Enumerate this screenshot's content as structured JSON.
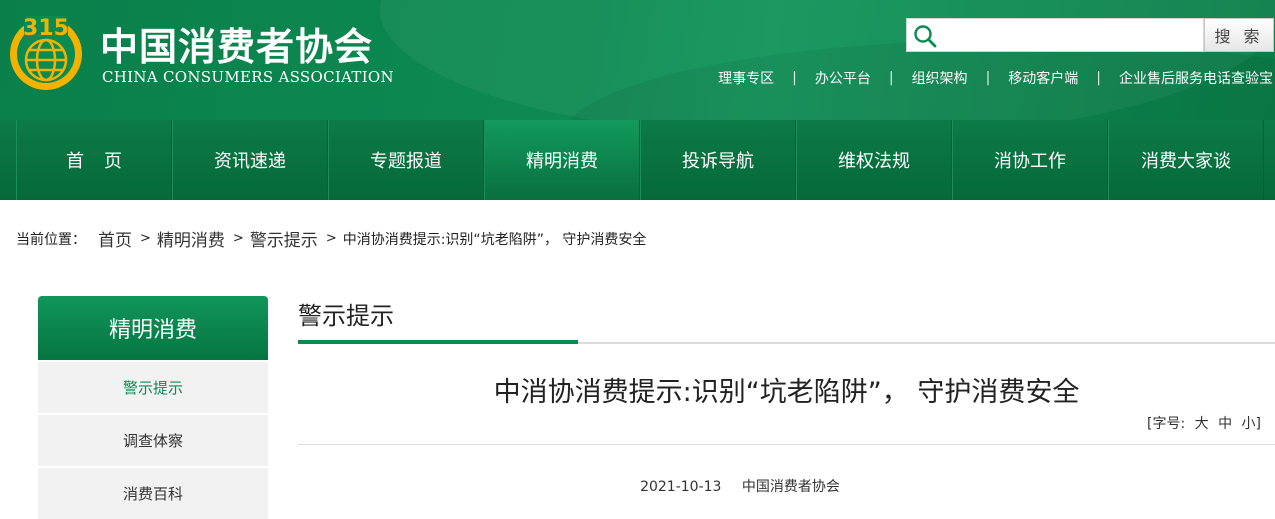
{
  "header": {
    "title": "中国消费者协会",
    "subtitle": "CHINA CONSUMERS ASSOCIATION",
    "logo_text": "315",
    "search": {
      "placeholder": "",
      "button_label": "搜 索"
    },
    "top_links": [
      "理事专区",
      "办公平台",
      "组织架构",
      "移动客户端",
      "企业售后服务电话查验宝"
    ],
    "separator": "|"
  },
  "nav": {
    "items": [
      "首页",
      "资讯速递",
      "专题报道",
      "精明消费",
      "投诉导航",
      "维权法规",
      "消协工作",
      "消费大家谈"
    ],
    "active_index": 3
  },
  "breadcrumb": {
    "prefix": "当前位置：",
    "items": [
      "首页",
      "精明消费",
      "警示提示",
      "中消协消费提示:识别“坑老陷阱”， 守护消费安全"
    ],
    "arrow": ">"
  },
  "sidebar": {
    "title": "精明消费",
    "items": [
      "警示提示",
      "调查体察",
      "消费百科"
    ],
    "active_index": 0
  },
  "main": {
    "section_title": "警示提示",
    "article_title": "中消协消费提示:识别“坑老陷阱”， 守护消费安全",
    "font_size": {
      "label": "[字号:",
      "large": "大",
      "medium": "中",
      "small": "小",
      "close": "]"
    },
    "date": "2021-10-13",
    "source": "中国消费者协会"
  },
  "colors": {
    "brand_green": "#0b8a52",
    "logo_gold": "#f2b300",
    "nav_dark": "#06693a"
  }
}
